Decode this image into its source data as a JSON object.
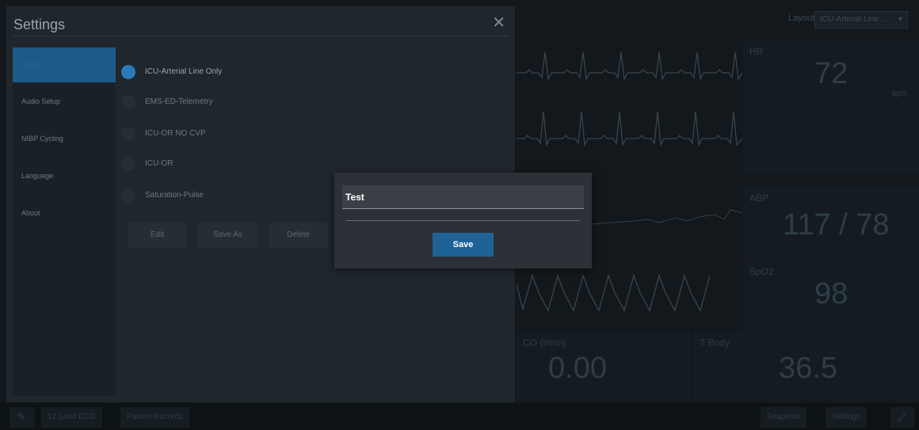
{
  "monitor": {
    "layout_label": "Layout",
    "layout_value": "ICU-Arterial Line ...",
    "tiles": {
      "hr": {
        "label": "HR",
        "value": "72",
        "unit": "bpm"
      },
      "abp": {
        "label": "ABP",
        "value": "117 / 78"
      },
      "spo2": {
        "label": "SpO2",
        "value": "98"
      },
      "co": {
        "label": "CO (l/min)",
        "value": "0.00"
      },
      "temp": {
        "label": "T Body",
        "value": "36.5"
      }
    },
    "bottom_bar": {
      "ecg_label": "12 Lead ECG",
      "records_label": "Patient Records",
      "snapshot_label": "Snapshot",
      "settings_label": "Settings"
    }
  },
  "settings": {
    "title": "Settings",
    "close_glyph": "✕",
    "sidebar": [
      "Layout",
      "Audio Setup",
      "NIBP Cycling",
      "Language",
      "About"
    ],
    "layouts": [
      {
        "label": "ICU-Arterial Line Only",
        "selected": true
      },
      {
        "label": "EMS-ED-Telemetry",
        "selected": false
      },
      {
        "label": "ICU-OR NO CVP",
        "selected": false
      },
      {
        "label": "ICU-OR",
        "selected": false
      },
      {
        "label": "Saturation-Pulse",
        "selected": false
      }
    ],
    "buttons": {
      "edit": "Edit",
      "save_as": "Save As",
      "delete": "Delete"
    }
  },
  "dialog": {
    "name_value": "Test",
    "save_label": "Save"
  },
  "colors": {
    "accent": "#1f6396",
    "radio_selected": "#2d7ab8",
    "sidebar_active": "#1e5a87"
  }
}
